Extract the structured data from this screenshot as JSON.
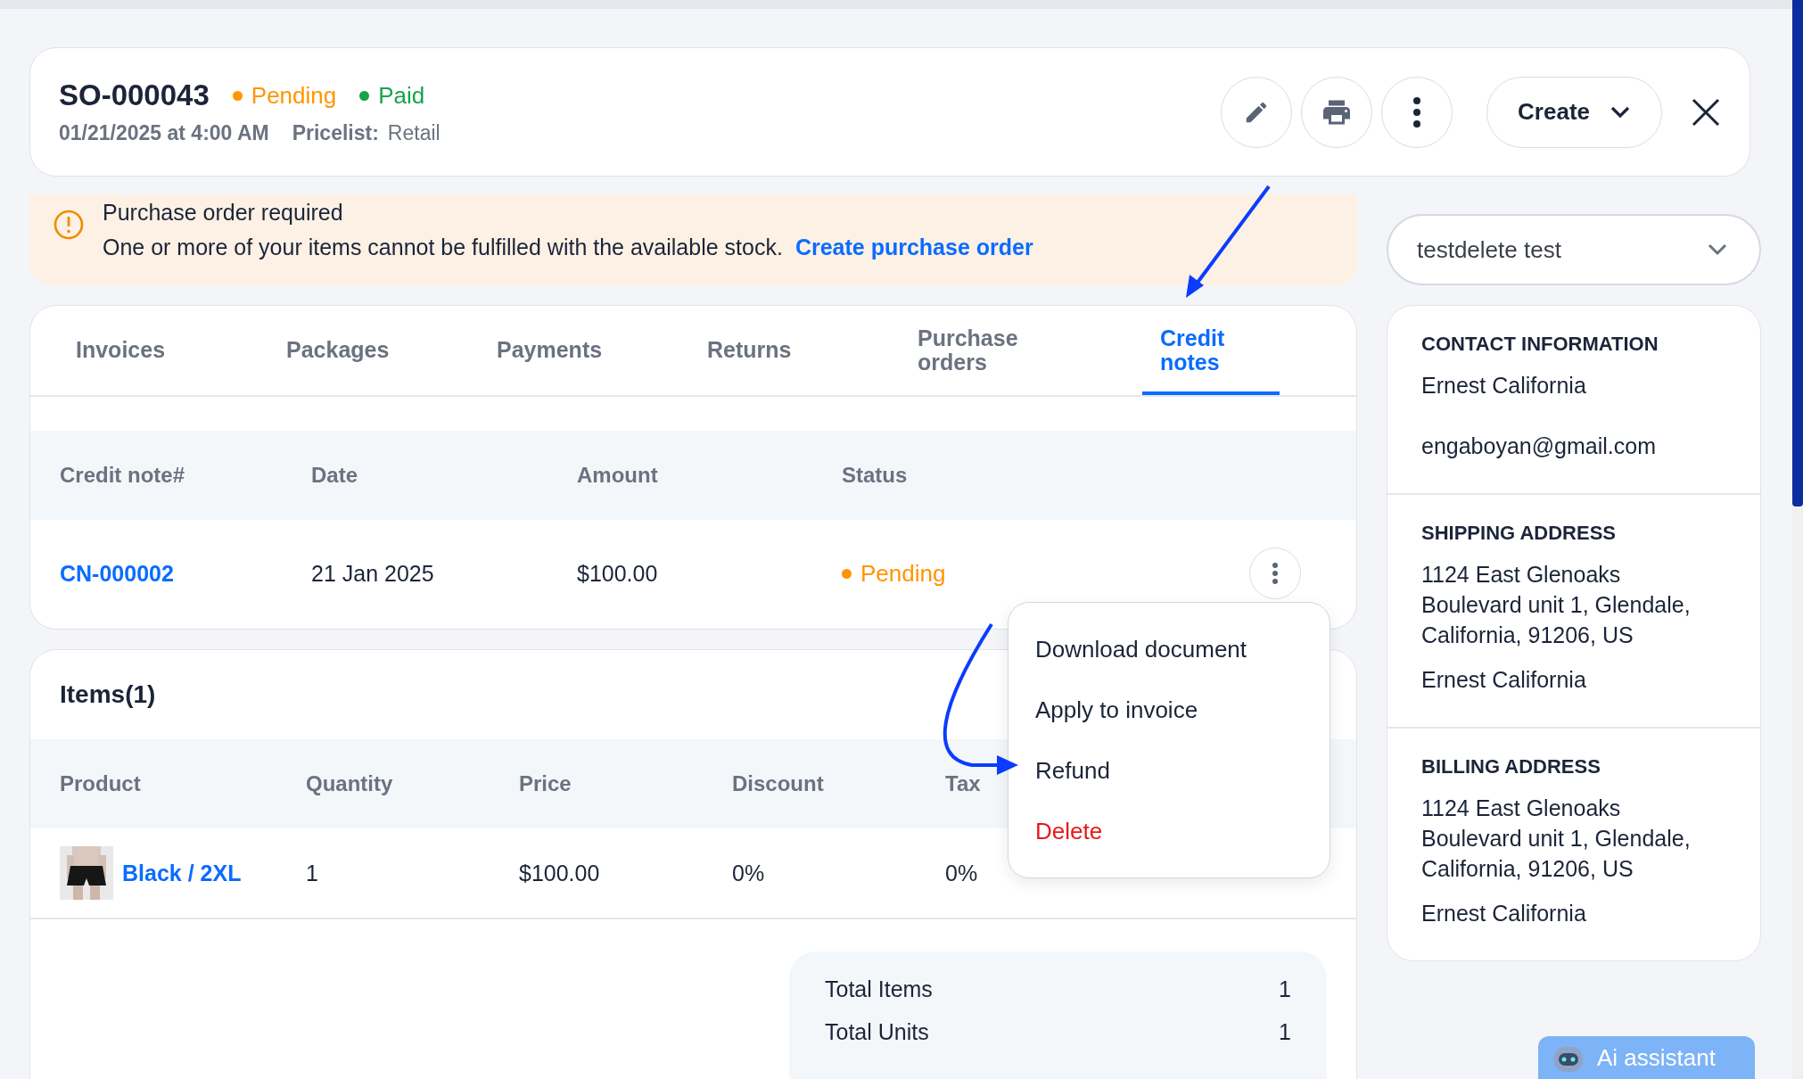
{
  "header": {
    "order_number": "SO-000043",
    "statuses": [
      {
        "label": "Pending",
        "color": "#ff9500"
      },
      {
        "label": "Paid",
        "color": "#16a34a"
      }
    ],
    "date": "01/21/2025 at 4:00 AM",
    "pricelist_label": "Pricelist:",
    "pricelist": "Retail",
    "create_button": "Create"
  },
  "alert": {
    "title": "Purchase order required",
    "message": "One or more of your items cannot be fulfilled with the available stock.",
    "link": "Create purchase order"
  },
  "tabs": [
    {
      "label": "Invoices",
      "selected": false
    },
    {
      "label": "Packages",
      "selected": false
    },
    {
      "label": "Payments",
      "selected": false
    },
    {
      "label": "Returns",
      "selected": false
    },
    {
      "label": "Purchase orders",
      "selected": false
    },
    {
      "label": "Credit notes",
      "selected": true
    }
  ],
  "credit_notes": {
    "columns": [
      "Credit note#",
      "Date",
      "Amount",
      "Status"
    ],
    "rows": [
      {
        "number": "CN-000002",
        "date": "21 Jan 2025",
        "amount": "$100.00",
        "status": "Pending",
        "color": "#ff9500"
      }
    ]
  },
  "row_menu": {
    "items": [
      {
        "label": "Download document",
        "kind": "normal"
      },
      {
        "label": "Apply to invoice",
        "kind": "normal"
      },
      {
        "label": "Refund",
        "kind": "normal"
      },
      {
        "label": "Delete",
        "kind": "danger"
      }
    ]
  },
  "items": {
    "title": "Items(1)",
    "columns": [
      "Product",
      "Quantity",
      "Price",
      "Discount",
      "Tax"
    ],
    "rows": [
      {
        "product": "Black / 2XL",
        "quantity": "1",
        "price": "$100.00",
        "discount": "0%",
        "tax": "0%"
      }
    ],
    "summary": [
      {
        "label": "Total Items",
        "value": "1"
      },
      {
        "label": "Total Units",
        "value": "1"
      }
    ]
  },
  "customer_select": {
    "value": "testdelete test"
  },
  "customer_info": [
    {
      "title": "CONTACT INFORMATION",
      "lines": [
        {
          "kind": "name",
          "text": "Ernest California"
        },
        {
          "kind": "email",
          "text": "engaboyan@gmail.com"
        }
      ]
    },
    {
      "title": "SHIPPING ADDRESS",
      "lines": [
        {
          "kind": "address",
          "text": "1124 East Glenoaks Boulevard unit 1, Glendale, California, 91206, US"
        },
        {
          "kind": "name",
          "text": "Ernest California"
        }
      ]
    },
    {
      "title": "BILLING ADDRESS",
      "lines": [
        {
          "kind": "address",
          "text": "1124 East Glenoaks Boulevard unit 1, Glendale, California, 91206, US"
        },
        {
          "kind": "name",
          "text": "Ernest California"
        }
      ]
    }
  ],
  "assistant_button": {
    "label": "Ai assistant"
  }
}
